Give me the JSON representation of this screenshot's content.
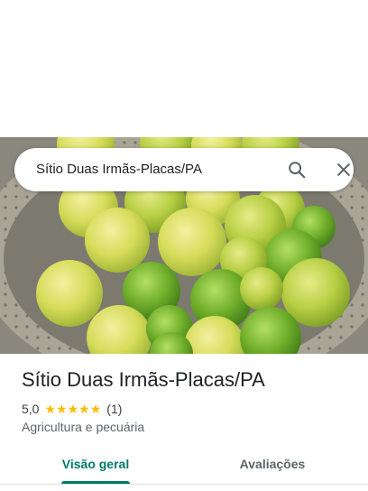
{
  "search": {
    "query": "Sítio Duas Irmãs-Placas/PA",
    "search_icon": "search-icon",
    "close_icon": "close-icon"
  },
  "photo": {
    "subject": "limes in colander"
  },
  "place": {
    "name": "Sítio Duas Irmãs-Placas/PA",
    "rating": "5,0",
    "stars": 5,
    "review_count": "(1)",
    "category": "Agricultura e pecuária"
  },
  "tabs": [
    {
      "label": "Visão geral",
      "active": true
    },
    {
      "label": "Avaliações",
      "active": false
    }
  ],
  "colors": {
    "accent": "#00796b",
    "star": "#fbbc04"
  }
}
